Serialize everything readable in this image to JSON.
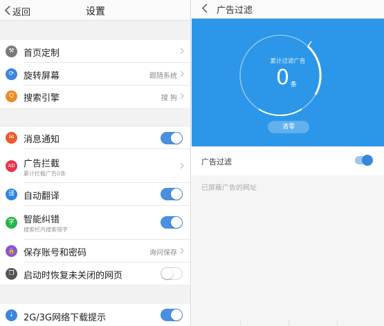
{
  "left": {
    "back_label": "返回",
    "title": "设置",
    "rows": [
      {
        "label": "首页定制",
        "icon": "wrench-icon",
        "glyph": "⚒",
        "color": "#7a7a7a"
      },
      {
        "label": "旋转屏幕",
        "value": "跟随系统",
        "icon": "rotate-screen-icon",
        "glyph": "⟳",
        "color": "#3a86e0"
      },
      {
        "label": "搜索引擎",
        "value": "搜 狗",
        "icon": "search-icon",
        "glyph": "Q",
        "color": "#f08a24"
      },
      {
        "label": "消息通知",
        "icon": "notification-icon",
        "glyph": "✉",
        "color": "#f05a2a"
      },
      {
        "label": "广告拦截",
        "sub": "累计拦截广告0条",
        "icon": "ad-block-icon",
        "glyph": "AD",
        "color": "#e8344e"
      },
      {
        "label": "自动翻译",
        "icon": "translate-icon",
        "glyph": "译",
        "color": "#2b86e6"
      },
      {
        "label": "智能纠错",
        "sub": "搜索栏内搜索错字",
        "icon": "spell-check-icon",
        "glyph": "字",
        "color": "#24b54a"
      },
      {
        "label": "保存账号和密码",
        "value": "询问保存",
        "icon": "lock-icon",
        "glyph": "🔒",
        "color": "#8b54d0"
      },
      {
        "label": "启动时恢复未关闭的网页",
        "icon": "restore-pages-icon",
        "glyph": "❐",
        "color": "#555555"
      },
      {
        "label": "2G/3G网络下载提示",
        "icon": "download-prompt-icon",
        "glyph": "⇣",
        "color": "#3a86e0"
      }
    ],
    "toggles": {
      "notifications": true,
      "translate": true,
      "spellcheck": true,
      "restore": false,
      "network_prompt": true
    }
  },
  "right": {
    "title": "广告过滤",
    "hero_label": "累计过滤广告",
    "count": "0",
    "count_unit": "条",
    "clear_button": "清零",
    "filter_label": "广告过滤",
    "filter_on": true,
    "blocked_sites_label": "已屏蔽广告的网址",
    "accent": "#2c97e8"
  }
}
